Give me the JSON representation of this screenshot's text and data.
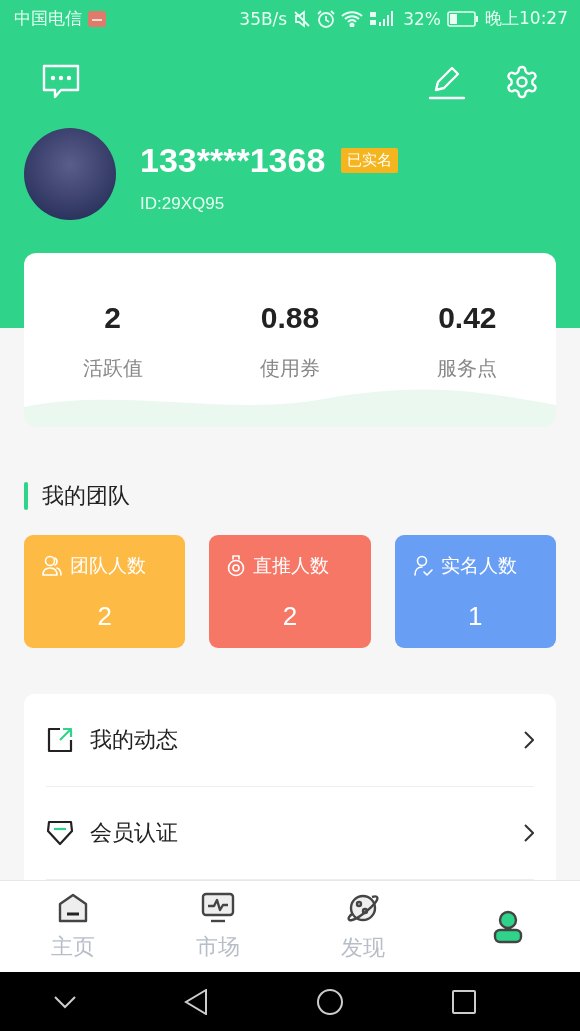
{
  "status_bar": {
    "carrier": "中国电信",
    "speed": "35B/s",
    "battery": "32%",
    "time": "晚上10:27"
  },
  "profile": {
    "phone": "133****1368",
    "badge": "已实名",
    "id": "ID:29XQ95"
  },
  "stats": [
    {
      "value": "2",
      "label": "活跃值"
    },
    {
      "value": "0.88",
      "label": "使用券"
    },
    {
      "value": "0.42",
      "label": "服务点"
    }
  ],
  "team": {
    "title": "我的团队",
    "cards": [
      {
        "kind": "team",
        "label": "团队人数",
        "value": "2",
        "color": "#fdba45"
      },
      {
        "kind": "direct",
        "label": "直推人数",
        "value": "2",
        "color": "#f67766"
      },
      {
        "kind": "verified",
        "label": "实名人数",
        "value": "1",
        "color": "#699ef5"
      }
    ]
  },
  "menu": [
    {
      "kind": "posts",
      "label": "我的动态"
    },
    {
      "kind": "member",
      "label": "会员认证"
    }
  ],
  "tabs": [
    {
      "kind": "home",
      "label": "主页",
      "selected": false
    },
    {
      "kind": "market",
      "label": "市场",
      "selected": false
    },
    {
      "kind": "discover",
      "label": "发现",
      "selected": false
    },
    {
      "kind": "mine",
      "selected": true
    }
  ]
}
